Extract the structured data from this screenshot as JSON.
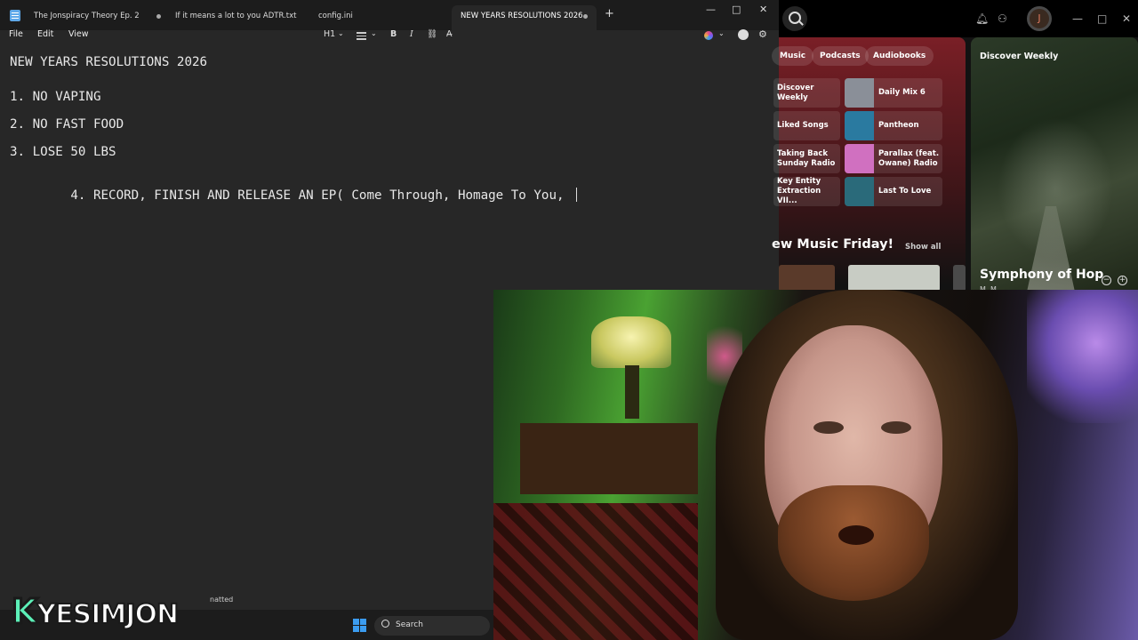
{
  "notepad": {
    "tabs": [
      {
        "label": "The Jonspiracy Theory Ep. 2"
      },
      {
        "label": "If it means a lot to you ADTR.txt"
      },
      {
        "label": "config.ini"
      },
      {
        "label": "NEW YEARS RESOLUTIONS 2026"
      }
    ],
    "add_tab": "+",
    "window_controls": {
      "minimize": "—",
      "maximize": "□",
      "close": "✕"
    },
    "menu": {
      "file": "File",
      "edit": "Edit",
      "view": "View"
    },
    "toolbar": {
      "heading": "H1",
      "heading_chevron": "⌄",
      "list_chevron": "⌄",
      "bold": "B",
      "italic": "I",
      "link": "⛓",
      "clear_format": "A̶",
      "copilot_chevron": "⌄"
    },
    "document": {
      "title": "NEW YEARS RESOLUTIONS 2026",
      "lines": [
        "1. NO VAPING",
        "2. NO FAST FOOD",
        "3. LOSE 50 LBS",
        "4. RECORD, FINISH AND RELEASE AN EP( Come Through, Homage To You, "
      ]
    },
    "status_fragment": "natted"
  },
  "spotify": {
    "avatar_letter": "J",
    "window_controls": {
      "minimize": "—",
      "maximize": "□",
      "close": "✕"
    },
    "chips": [
      "Music",
      "Podcasts",
      "Audiobooks"
    ],
    "cards": [
      {
        "label": "Discover Weekly",
        "color": "#6a3a40"
      },
      {
        "label": "Daily Mix 6",
        "color": "#8a8f98"
      },
      {
        "label": "Liked Songs",
        "color": "#5a3ab8"
      },
      {
        "label": "Pantheon",
        "color": "#2a7aa0"
      },
      {
        "label": "Taking Back Sunday Radio",
        "color": "#4a4040"
      },
      {
        "label": "Parallax (feat. Owane) Radio",
        "color": "#d070c0"
      },
      {
        "label": "Key Entity Extraction VII...",
        "color": "#3a3030"
      },
      {
        "label": "Last To Love",
        "color": "#2a6a7a"
      }
    ],
    "new_music_friday": "ew Music Friday!",
    "show_all": "Show all",
    "featured": {
      "heading": "Discover Weekly",
      "title": "Symphony of Hop",
      "subtitle": "M. M...",
      "minus": "−",
      "plus": "+"
    }
  },
  "taskbar": {
    "search_label": "Search"
  },
  "overlay": {
    "logo_k": "K",
    "logo_rest": "YESIMJON"
  }
}
